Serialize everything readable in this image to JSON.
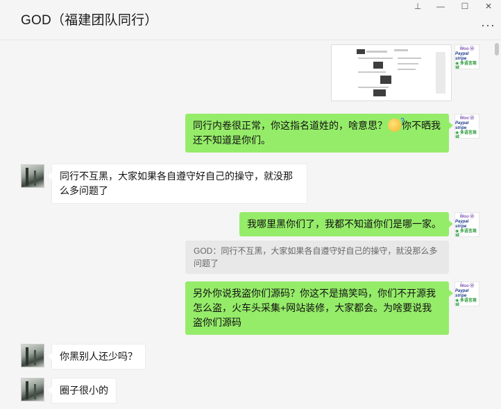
{
  "window": {
    "title": "GOD（福建团队同行）",
    "controls": {
      "pin": "⊥",
      "minimize": "—",
      "maximize": "☐",
      "close": "✕"
    },
    "more": "···"
  },
  "my_avatar": {
    "line1": "opencart",
    "line2": "Woo ⓦ",
    "line3": "Paypal stripe",
    "line4": "◉ 多语言商城"
  },
  "messages": [
    {
      "id": "m1",
      "side": "right",
      "type": "image"
    },
    {
      "id": "m2",
      "side": "right",
      "text_a": "同行内卷很正常，你这指名道姓的，啥意思？",
      "text_b": "你不晒我",
      "text_c": "还不知道是你们。",
      "emoji": "thinking-face"
    },
    {
      "id": "m3",
      "side": "left",
      "text": "同行不互黑，大家如果各自遵守好自己的操守，就没那么多问题了"
    },
    {
      "id": "m4",
      "side": "right",
      "text": "我哪里黑你们了，我都不知道你们是哪一家。"
    },
    {
      "id": "m5",
      "side": "right",
      "type": "quote",
      "text": "GOD：同行不互黑，大家如果各自遵守好自己的操守，就没那么多问题了"
    },
    {
      "id": "m6",
      "side": "right",
      "text": "另外你说我盗你们源码？你这不是搞笑吗，你们不开源我怎么盗，火车头采集+网站装修，大家都会。为啥要说我盗你们源码"
    },
    {
      "id": "m7",
      "side": "left",
      "text": "你黑别人还少吗？"
    },
    {
      "id": "m8",
      "side": "left",
      "text": "圈子很小的"
    }
  ]
}
